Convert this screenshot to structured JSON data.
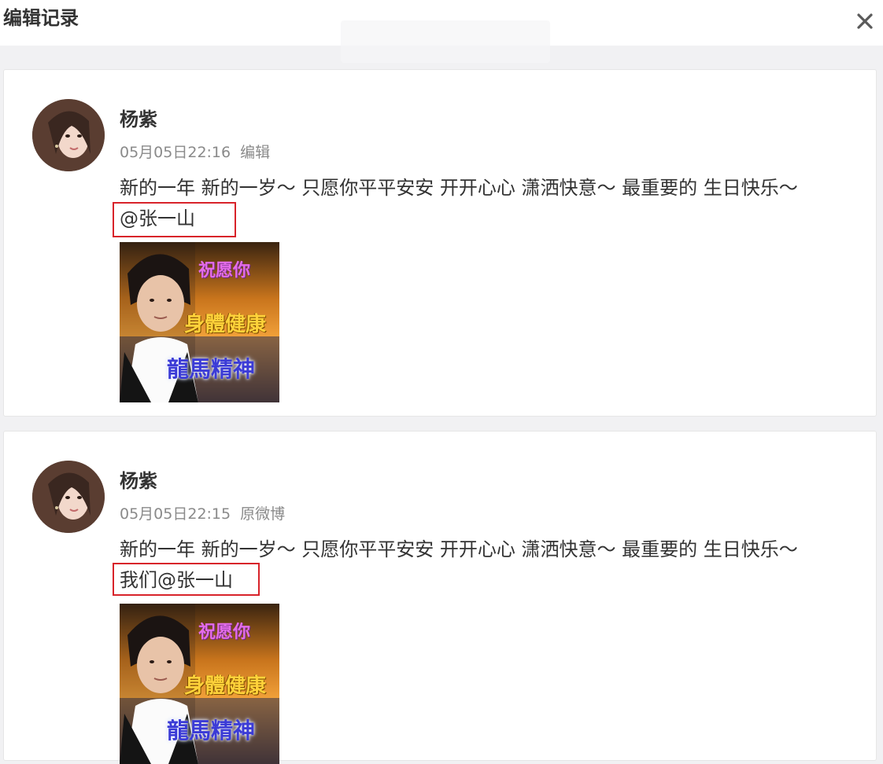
{
  "dialog": {
    "title": "编辑记录",
    "close_icon": "close-icon"
  },
  "records": [
    {
      "user_name": "杨紫",
      "timestamp": "05月05日22:16",
      "tag": "编辑",
      "text": "新的一年 新的一岁～ 只愿你平平安安 开开心心 潇洒快意～ 最重要的 生日快乐～",
      "mention_line": "@张一山",
      "image_captions": [
        "祝愿你",
        "身體健康",
        "龍馬精神"
      ]
    },
    {
      "user_name": "杨紫",
      "timestamp": "05月05日22:15",
      "tag": "原微博",
      "text": "新的一年 新的一岁～ 只愿你平平安安 开开心心 潇洒快意～ 最重要的 生日快乐～",
      "mention_line": "我们@张一山",
      "image_captions": [
        "祝愿你",
        "身體健康",
        "龍馬精神"
      ]
    }
  ],
  "colors": {
    "highlight_border": "#d8232a",
    "background": "#f1f1f3",
    "card": "#ffffff",
    "meta_text": "#8a8a8a",
    "body_text": "#333333"
  }
}
